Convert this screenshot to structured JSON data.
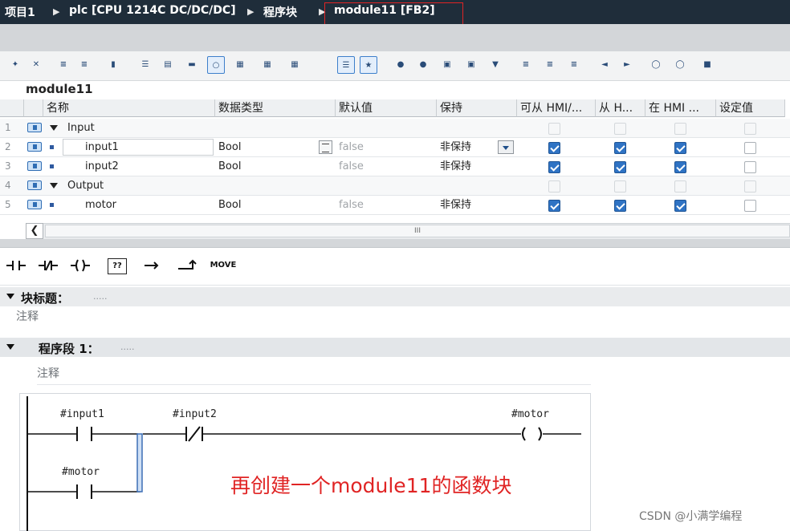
{
  "breadcrumb": {
    "items": [
      "项目1",
      "plc [CPU 1214C DC/DC/DC]",
      "程序块",
      "module11 [FB2]"
    ]
  },
  "block": {
    "name": "module11"
  },
  "table": {
    "columns": [
      "名称",
      "数据类型",
      "默认值",
      "保持",
      "可从 HMI/...",
      "从 H...",
      "在 HMI ...",
      "设定值"
    ],
    "rows": [
      {
        "num": "1",
        "kind": "section",
        "name": "Input",
        "type": "",
        "default": "",
        "retain": "",
        "hmi_access": false,
        "hmi_write": false,
        "hmi_visible": false,
        "setpoint": false
      },
      {
        "num": "2",
        "kind": "var",
        "name": "input1",
        "type": "Bool",
        "default": "false",
        "retain": "非保持",
        "hmi_access": true,
        "hmi_write": true,
        "hmi_visible": true,
        "setpoint": false
      },
      {
        "num": "3",
        "kind": "var",
        "name": "input2",
        "type": "Bool",
        "default": "false",
        "retain": "非保持",
        "hmi_access": true,
        "hmi_write": true,
        "hmi_visible": true,
        "setpoint": false
      },
      {
        "num": "4",
        "kind": "section",
        "name": "Output",
        "type": "",
        "default": "",
        "retain": "",
        "hmi_access": false,
        "hmi_write": false,
        "hmi_visible": false,
        "setpoint": false
      },
      {
        "num": "5",
        "kind": "var",
        "name": "motor",
        "type": "Bool",
        "default": "false",
        "retain": "非保持",
        "hmi_access": true,
        "hmi_write": true,
        "hmi_visible": true,
        "setpoint": false
      }
    ]
  },
  "scroll_thumb_label": "III",
  "ladder_toolbar": {
    "items": [
      {
        "label": "",
        "icon": "no-contact-icon"
      },
      {
        "label": "",
        "icon": "nc-contact-icon"
      },
      {
        "label": "",
        "icon": "coil-icon"
      },
      {
        "label": "??",
        "icon": "empty-box-icon"
      },
      {
        "label": "",
        "icon": "open-branch-icon"
      },
      {
        "label": "",
        "icon": "close-branch-icon"
      },
      {
        "label": "MOVE",
        "icon": "move-instruction-icon"
      }
    ]
  },
  "block_title": {
    "label": "块标题：",
    "dots": ".....",
    "comment": "注释"
  },
  "network": {
    "label": "程序段 1：",
    "dots": ".....",
    "comment": "注释",
    "tags": [
      "#input1",
      "#input2",
      "#motor",
      "#motor"
    ]
  },
  "annotation": "再创建一个module11的函数块",
  "watermark": "CSDN @小满学编程"
}
